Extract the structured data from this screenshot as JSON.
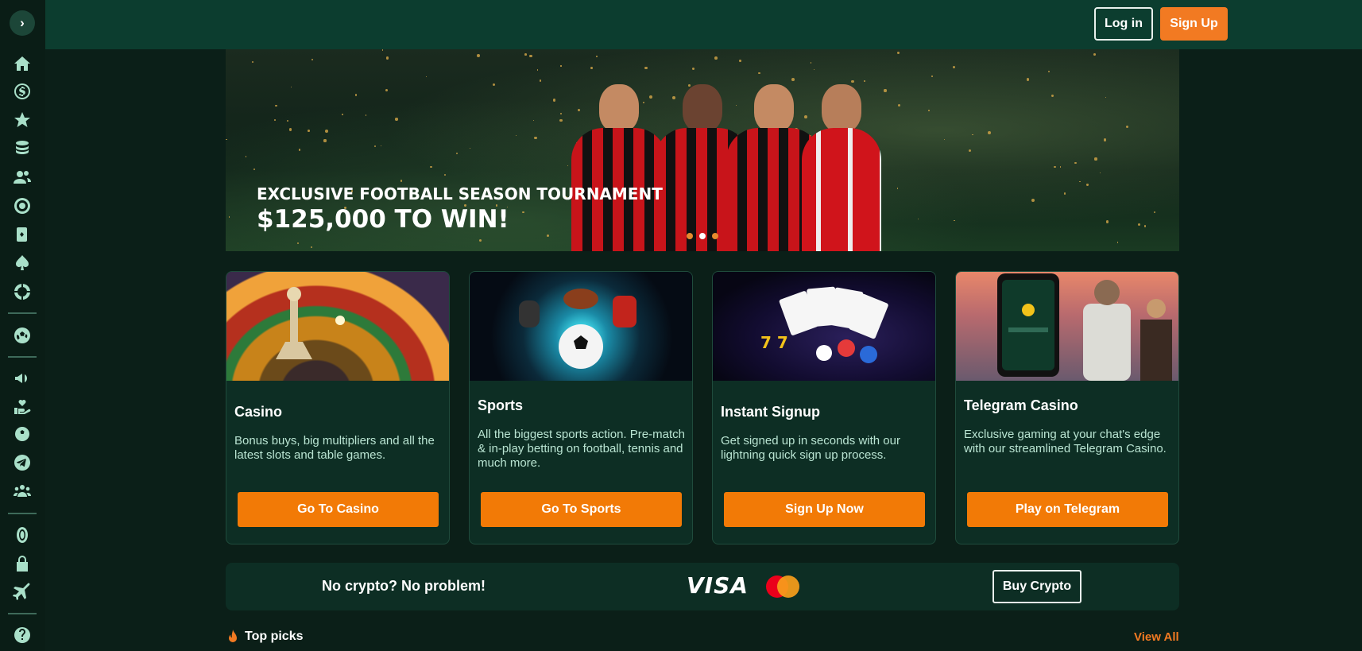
{
  "header": {
    "login_label": "Log in",
    "signup_label": "Sign Up"
  },
  "sidebar": {
    "toggle_glyph": "›",
    "items": [
      {
        "icon": "home-icon"
      },
      {
        "icon": "dollar-icon"
      },
      {
        "icon": "star-icon"
      },
      {
        "icon": "coins-icon"
      },
      {
        "icon": "users-icon"
      },
      {
        "icon": "roulette-icon"
      },
      {
        "icon": "cards-icon"
      },
      {
        "icon": "spade-icon"
      },
      {
        "icon": "poker-chip-icon"
      },
      {
        "icon": "football-icon"
      },
      {
        "icon": "megaphone-icon"
      },
      {
        "icon": "heart-hand-icon"
      },
      {
        "icon": "soccer-ball-icon"
      },
      {
        "icon": "telegram-icon"
      },
      {
        "icon": "group-icon"
      },
      {
        "icon": "coin-icon"
      },
      {
        "icon": "lock-icon"
      },
      {
        "icon": "plane-icon"
      },
      {
        "icon": "help-icon"
      }
    ]
  },
  "banner": {
    "title": "EXCLUSIVE FOOTBALL SEASON TOURNAMENT",
    "subtitle": "$125,000 TO WIN!",
    "slides": 3,
    "active_slide": 2
  },
  "cards": [
    {
      "title": "Casino",
      "description": "Bonus buys, big multipliers and all the latest slots and table games.",
      "button": "Go To Casino"
    },
    {
      "title": "Sports",
      "description": "All the biggest sports action. Pre-match & in-play betting on football, tennis and much more.",
      "button": "Go To Sports"
    },
    {
      "title": "Instant Signup",
      "description": "Get signed up in seconds with our lightning quick sign up process.",
      "button": "Sign Up Now"
    },
    {
      "title": "Telegram Casino",
      "description": "Exclusive gaming at your chat's edge with our streamlined Telegram Casino.",
      "button": "Play on Telegram"
    }
  ],
  "crypto_bar": {
    "text": "No crypto? No problem!",
    "visa_label": "VISA",
    "button": "Buy Crypto"
  },
  "top_picks": {
    "label": "Top picks",
    "view_all": "View All"
  },
  "colors": {
    "accent": "#f27a22",
    "background": "#0b1f18",
    "header": "#0c3d2f",
    "card": "#0d2e24"
  }
}
